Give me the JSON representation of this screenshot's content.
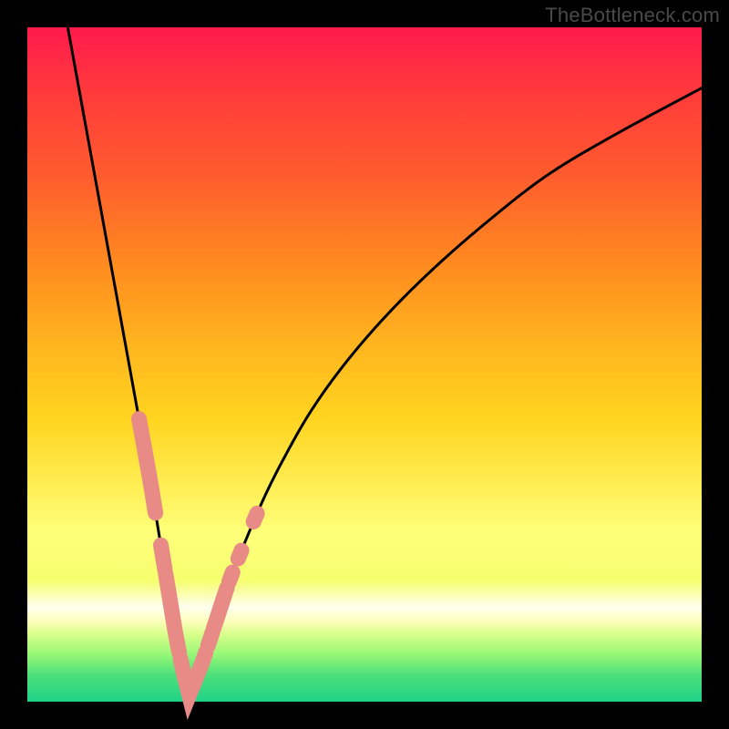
{
  "watermark": "TheBottleneck.com",
  "colors": {
    "frame": "#000000",
    "curve": "#000000",
    "marker_fill": "#e88a86",
    "marker_stroke": "#d66e69"
  },
  "chart_data": {
    "type": "line",
    "title": "",
    "xlabel": "",
    "ylabel": "",
    "xlim": [
      0,
      100
    ],
    "ylim": [
      0,
      100
    ],
    "grid": false,
    "legend": false,
    "description": "Bottleneck curve: a steep V-shaped black curve over a vertical red-to-green gradient. Minimum (best match) near x≈24. Salmon marker segments cluster near the trough on both arms.",
    "series": [
      {
        "name": "left-arm",
        "x": [
          6,
          8,
          10,
          12,
          14,
          16,
          18,
          19,
          20,
          21,
          22,
          23,
          24
        ],
        "values": [
          100,
          89,
          78,
          67,
          56,
          45,
          34,
          28,
          22,
          16,
          10,
          5,
          1
        ]
      },
      {
        "name": "right-arm",
        "x": [
          24,
          26,
          28,
          30,
          32,
          35,
          38,
          42,
          47,
          53,
          60,
          68,
          77,
          87,
          100
        ],
        "values": [
          1,
          6,
          12,
          18,
          23,
          30,
          36,
          43,
          50,
          57,
          64,
          71,
          78,
          84,
          91
        ]
      }
    ],
    "markers": [
      {
        "arm": "left",
        "x_start": 16.5,
        "x_end": 19.0
      },
      {
        "arm": "left",
        "x_start": 19.8,
        "x_end": 20.4
      },
      {
        "arm": "left",
        "x_start": 20.5,
        "x_end": 22.5
      },
      {
        "arm": "left",
        "x_start": 22.7,
        "x_end": 23.1
      },
      {
        "arm": "left",
        "x_start": 23.1,
        "x_end": 26.5
      },
      {
        "arm": "right",
        "x_start": 26.8,
        "x_end": 27.4
      },
      {
        "arm": "right",
        "x_start": 27.6,
        "x_end": 29.6
      },
      {
        "arm": "right",
        "x_start": 29.9,
        "x_end": 30.5
      },
      {
        "arm": "right",
        "x_start": 31.2,
        "x_end": 31.8
      },
      {
        "arm": "right",
        "x_start": 33.5,
        "x_end": 34.1
      }
    ]
  }
}
